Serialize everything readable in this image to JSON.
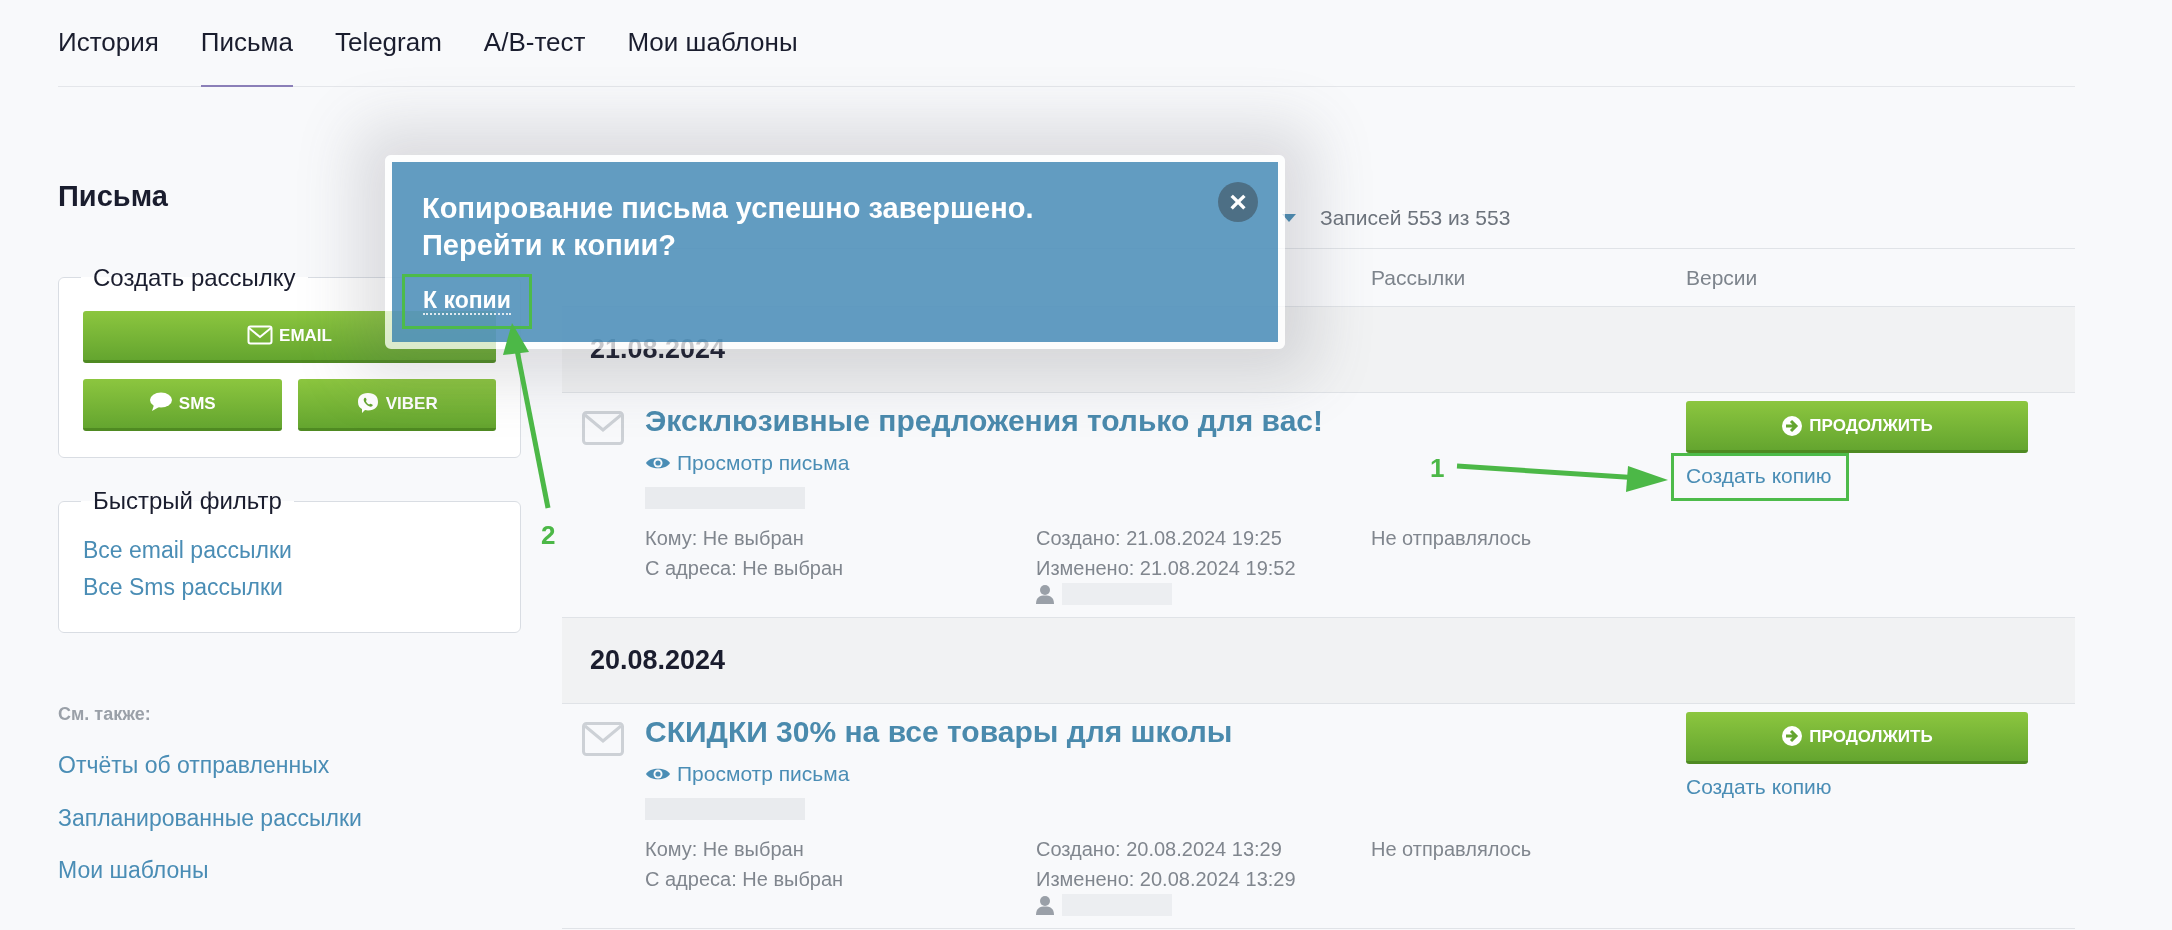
{
  "tabs": [
    {
      "label": "История",
      "selected": false
    },
    {
      "label": "Письма",
      "selected": true
    },
    {
      "label": "Telegram",
      "selected": false
    },
    {
      "label": "A/B-тест",
      "selected": false
    },
    {
      "label": "Мои шаблоны",
      "selected": false
    }
  ],
  "sidebar": {
    "title": "Письма",
    "create_group": {
      "legend": "Создать рассылку",
      "buttons": [
        {
          "label": "EMAIL",
          "kind": "email"
        },
        {
          "label": "SMS",
          "kind": "sms"
        },
        {
          "label": "VIBER",
          "kind": "viber"
        }
      ]
    },
    "quick_filter": {
      "legend": "Быстрый фильтр",
      "links": [
        "Все email рассылки",
        "Все Sms рассылки"
      ]
    },
    "see_also": {
      "title": "См. также:",
      "links": [
        "Отчёты об отправленных",
        "Запланированные рассылки",
        "Мои шаблоны"
      ]
    }
  },
  "toolbar": {
    "records": "Записей 553 из 553"
  },
  "table": {
    "columns": [
      "Рассылки",
      "Версии"
    ],
    "groups": [
      {
        "date": "21.08.2024",
        "items": [
          {
            "title": "Эксклюзивные предложения только для вас!",
            "view_link": "Просмотр письма",
            "to": "Кому: Не выбран",
            "from": "С адреса: Не выбран",
            "created": "Создано: 21.08.2024 19:25",
            "modified": "Изменено: 21.08.2024 19:52",
            "status": "Не отправлялось",
            "continue_button": "ПРОДОЛЖИТЬ",
            "copy_link": "Создать копию",
            "copy_highlighted": true
          }
        ]
      },
      {
        "date": "20.08.2024",
        "items": [
          {
            "title": "СКИДКИ 30% на все товары для школы",
            "view_link": "Просмотр письма",
            "to": "Кому: Не выбран",
            "from": "С адреса: Не выбран",
            "created": "Создано: 20.08.2024 13:29",
            "modified": "Изменено: 20.08.2024 13:29",
            "status": "Не отправлялось",
            "continue_button": "ПРОДОЛЖИТЬ",
            "copy_link": "Создать копию",
            "copy_highlighted": false
          }
        ]
      }
    ]
  },
  "popup": {
    "lines": [
      "Копирование письма успешно завершено.",
      "Перейти к копии?"
    ],
    "link": "К копии",
    "link_highlighted": true,
    "close": "×"
  },
  "annotations": [
    {
      "label": "1",
      "kind": "right"
    },
    {
      "label": "2",
      "kind": "up"
    }
  ]
}
